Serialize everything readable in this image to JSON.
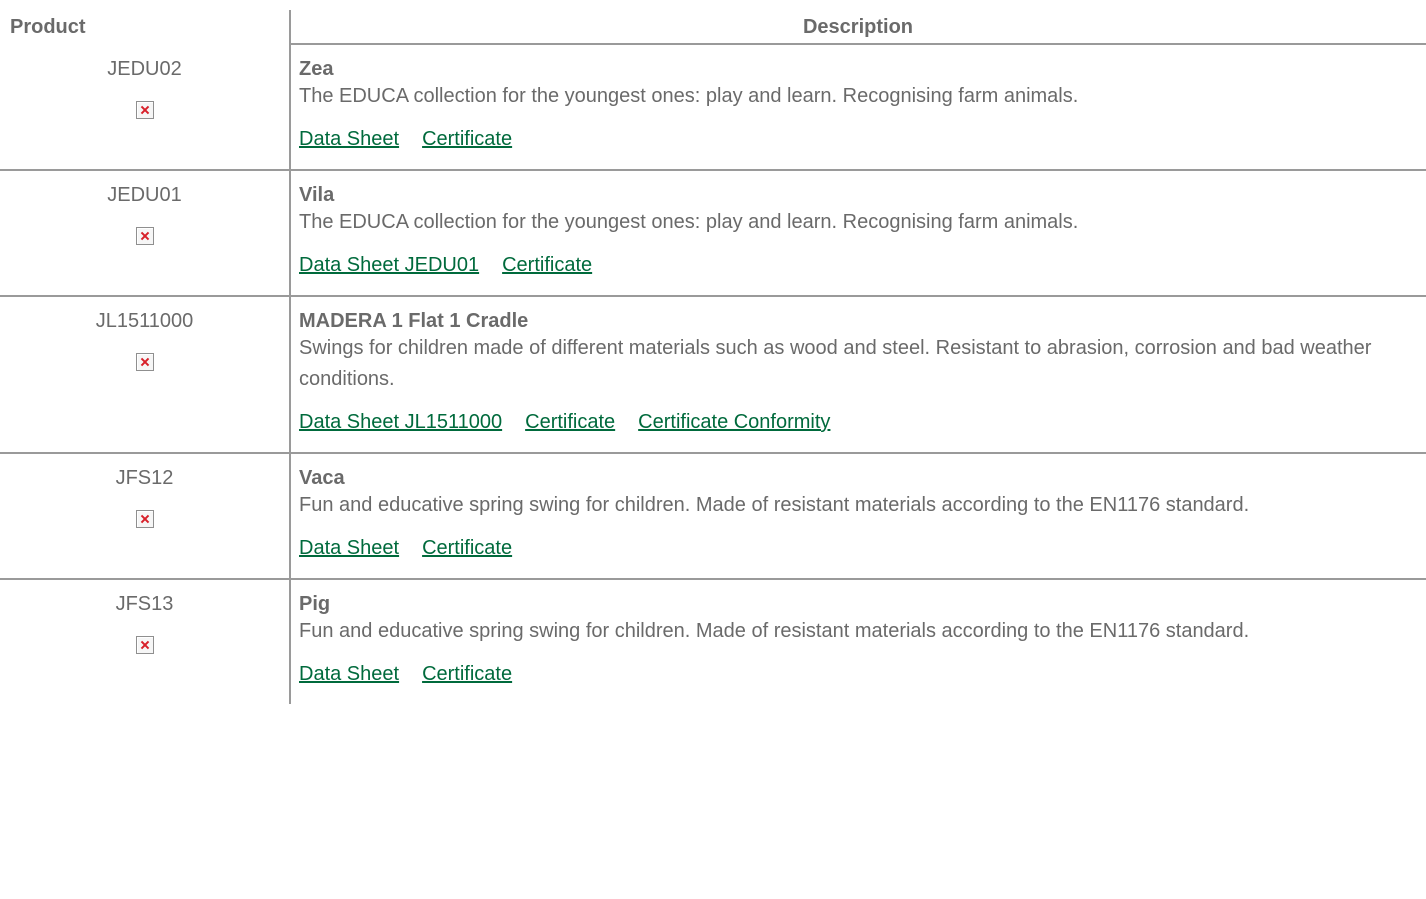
{
  "header": {
    "product": "Product",
    "description": "Description"
  },
  "rows": [
    {
      "code": "JEDU02",
      "title": "Zea",
      "text": "The EDUCA collection for the youngest ones: play and learn. Recognising farm animals.",
      "links": [
        "Data Sheet",
        "Certificate"
      ]
    },
    {
      "code": "JEDU01",
      "title": "Vila",
      "text": "The EDUCA collection for the youngest ones: play and learn. Recognising farm animals.",
      "links": [
        "Data Sheet JEDU01",
        "Certificate"
      ]
    },
    {
      "code": "JL1511000",
      "title": "MADERA 1 Flat 1 Cradle",
      "text": "Swings for children made of different materials such as wood and steel. Resistant to abrasion, corrosion and bad weather conditions.",
      "links": [
        "Data Sheet JL1511000",
        "Certificate",
        "Certificate Conformity"
      ]
    },
    {
      "code": "JFS12",
      "title": "Vaca",
      "text": "Fun and educative spring swing for children. Made of resistant materials according to the EN1176 standard.",
      "links": [
        "Data Sheet",
        "Certificate"
      ]
    },
    {
      "code": "JFS13",
      "title": "Pig",
      "text": "Fun and educative spring swing for children. Made of resistant materials according to the EN1176 standard.",
      "links": [
        "Data Sheet",
        "Certificate"
      ]
    }
  ],
  "colors": {
    "text": "#6a6a6a",
    "link": "#006a3c",
    "rule": "#9a9a9a",
    "broken_image_x": "#d8202a"
  },
  "icons": {
    "product_image": "broken-image-icon"
  }
}
